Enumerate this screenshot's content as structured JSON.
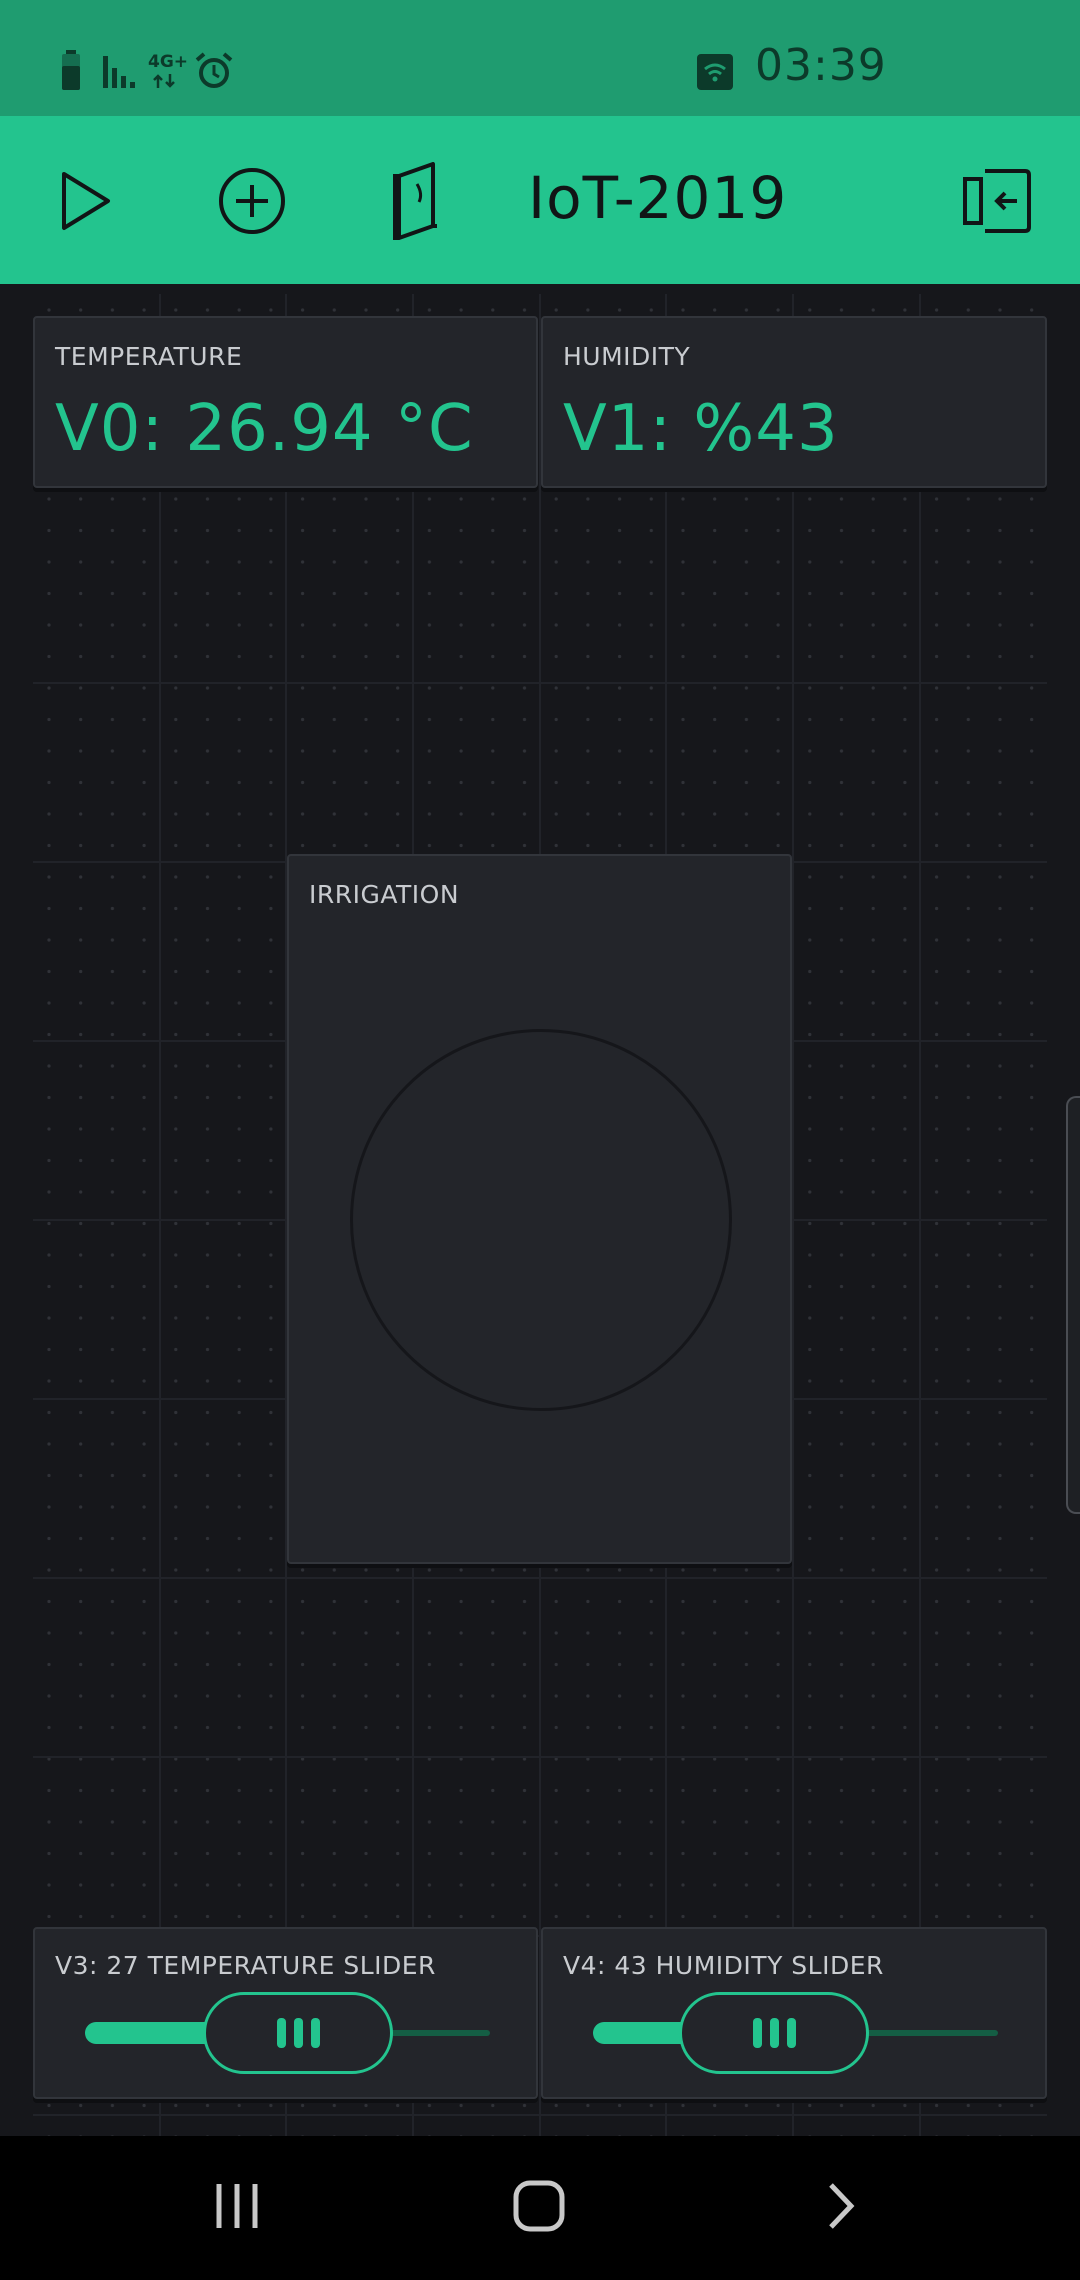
{
  "status_bar": {
    "time": "03:39",
    "network_label": "4G+",
    "icons": [
      "battery-icon",
      "signal-icon",
      "network-4g-icon",
      "alarm-icon",
      "wifi-icon"
    ]
  },
  "toolbar": {
    "title": "IoT-2019",
    "icons": [
      "play-icon",
      "add-widget-icon",
      "device-icon",
      "logout-icon"
    ]
  },
  "widgets": {
    "temperature": {
      "label": "TEMPERATURE",
      "value": "V0: 26.94 °C"
    },
    "humidity": {
      "label": "HUMIDITY",
      "value": "V1: %43"
    },
    "irrigation": {
      "label": "IRRIGATION"
    },
    "temperature_slider": {
      "label": "V3: 27 TEMPERATURE SLIDER",
      "value": 27
    },
    "humidity_slider": {
      "label": "V4: 43 HUMIDITY SLIDER",
      "value": 43
    }
  },
  "nav_bar": {
    "icons": [
      "recent-apps-icon",
      "home-icon",
      "back-icon"
    ]
  },
  "colors": {
    "accent": "#23c48e",
    "status_bar": "#1f9c70",
    "background": "#16171b",
    "widget": "#23252a"
  }
}
